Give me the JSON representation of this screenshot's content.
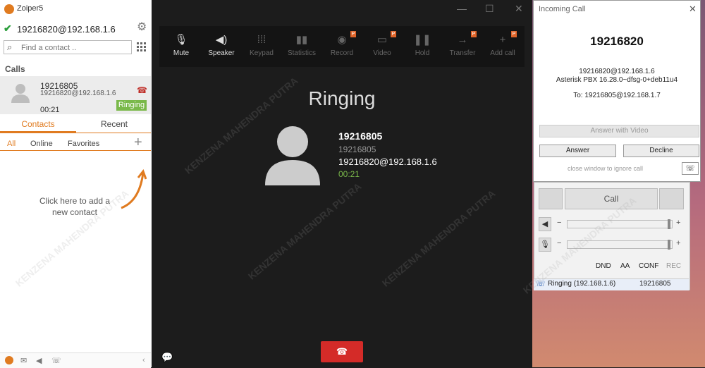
{
  "app": {
    "title": "Zoiper5",
    "account": "19216820@192.168.1.6"
  },
  "search": {
    "placeholder": "Find a contact .."
  },
  "calls": {
    "header": "Calls",
    "item": {
      "number": "19216805",
      "address": "19216820@192.168.1.6",
      "duration": "00:21",
      "status": "Ringing"
    }
  },
  "contacts_tabs": {
    "contacts": "Contacts",
    "recent": "Recent"
  },
  "filters": {
    "all": "All",
    "online": "Online",
    "favorites": "Favorites"
  },
  "hint": "Click here to add a new contact",
  "toolbar": {
    "mute": "Mute",
    "speaker": "Speaker",
    "keypad": "Keypad",
    "statistics": "Statistics",
    "record": "Record",
    "video": "Video",
    "hold": "Hold",
    "transfer": "Transfer",
    "add_call": "Add call",
    "premium_badge": "P"
  },
  "call_view": {
    "title": "Ringing",
    "name": "19216805",
    "number": "19216805",
    "sip": "19216820@192.168.1.6",
    "duration": "00:21"
  },
  "incoming": {
    "window_title": "Incoming Call",
    "number": "19216820",
    "line1": "19216820@192.168.1.6",
    "line2": "Asterisk PBX 16.28.0~dfsg-0+deb11u4",
    "to": "To: 19216805@192.168.1.7",
    "answer_video": "Answer with Video",
    "answer": "Answer",
    "decline": "Decline",
    "ignore_hint": "close window to ignore call"
  },
  "side_panel": {
    "call": "Call",
    "options": [
      "DND",
      "AA",
      "CONF",
      "REC"
    ],
    "status_left": "Ringing (192.168.1.6)",
    "status_right": "19216805",
    "slider_minus": "−",
    "slider_plus": "+"
  },
  "watermark": "KENZENA MAHENDRA PUTRA",
  "colors": {
    "accent": "#e07b20",
    "ringing": "#7ab94a",
    "hangup": "#d42b28",
    "premium": "#e0652a"
  }
}
